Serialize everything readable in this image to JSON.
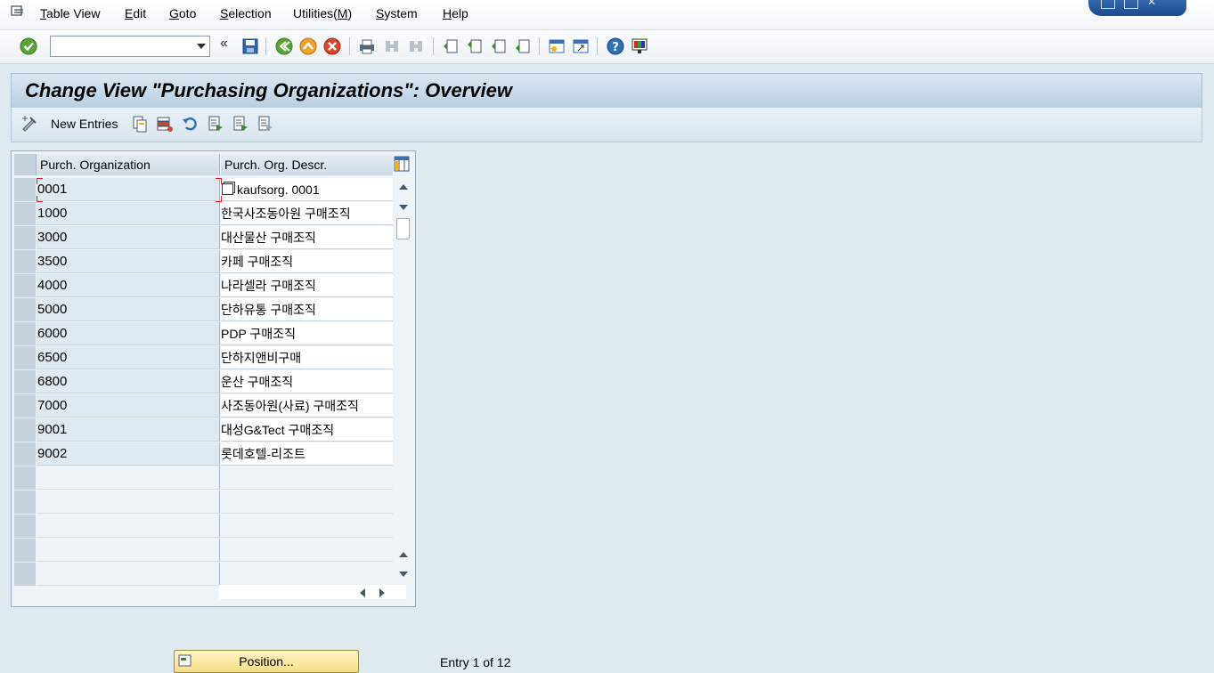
{
  "menu": {
    "items": [
      {
        "label": "Table View",
        "underline": "T",
        "rest": "able View"
      },
      {
        "label": "Edit",
        "underline": "E",
        "rest": "dit"
      },
      {
        "label": "Goto",
        "underline": "G",
        "rest": "oto"
      },
      {
        "label": "Selection",
        "underline": "S",
        "rest": "election"
      },
      {
        "label": "Utilities(M)",
        "prefix": "Utilities(",
        "underline": "M",
        "suffix": ")"
      },
      {
        "label": "System",
        "underline": "S",
        "rest": "ystem"
      },
      {
        "label": "Help",
        "underline": "H",
        "rest": "elp"
      }
    ]
  },
  "toolbar": {
    "command_field_value": "",
    "icons": [
      "enter-icon",
      "save-icon",
      "back-icon",
      "exit-icon",
      "cancel-icon",
      "print-icon",
      "find-icon",
      "find-next-icon",
      "first-page-icon",
      "previous-page-icon",
      "next-page-icon",
      "last-page-icon",
      "create-session-icon",
      "generate-shortcut-icon",
      "help-icon",
      "customize-layout-icon"
    ]
  },
  "title": "Change View \"Purchasing Organizations\": Overview",
  "app_toolbar": {
    "new_entries_label": "New Entries",
    "icons": [
      "display-change-icon",
      "copy-as-icon",
      "delete-icon",
      "undo-change-icon",
      "select-all-icon",
      "select-block-icon",
      "deselect-all-icon"
    ]
  },
  "table": {
    "columns": [
      "Purch. Organization",
      "Purch. Org. Descr."
    ],
    "rows": [
      {
        "org": "0001",
        "descr": "kaufsorg. 0001"
      },
      {
        "org": "1000",
        "descr": "한국사조동아원 구매조직"
      },
      {
        "org": "3000",
        "descr": "대산물산 구매조직"
      },
      {
        "org": "3500",
        "descr": "카페 구매조직"
      },
      {
        "org": "4000",
        "descr": "나라셀라 구매조직"
      },
      {
        "org": "5000",
        "descr": "단하유통 구매조직"
      },
      {
        "org": "6000",
        "descr": "PDP 구매조직"
      },
      {
        "org": "6500",
        "descr": "단하지앤비구매"
      },
      {
        "org": "6800",
        "descr": "운산 구매조직"
      },
      {
        "org": "7000",
        "descr": "사조동아원(사료) 구매조직"
      },
      {
        "org": "9001",
        "descr": "대성G&Tect 구매조직"
      },
      {
        "org": "9002",
        "descr": "롯데호텔-리조트"
      }
    ],
    "empty_rows": 5
  },
  "footer": {
    "position_label": "Position...",
    "entry_info": "Entry 1 of 12"
  },
  "colors": {
    "background": "#dfe9f0",
    "title_bar": "#c8daea",
    "key_column": "#dfe9f2",
    "position_button": "#f7df86"
  }
}
